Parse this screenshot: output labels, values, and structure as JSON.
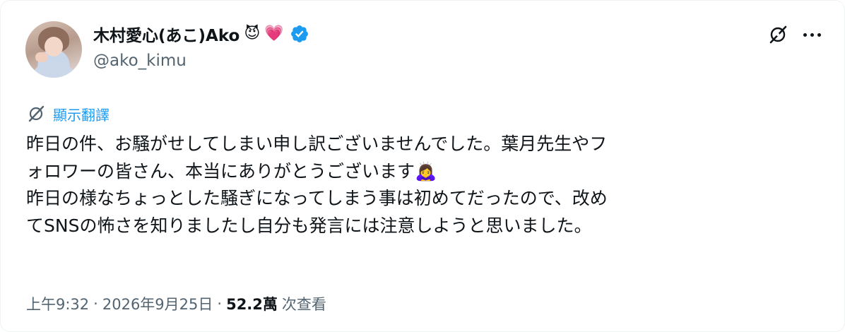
{
  "author": {
    "display_name": "木村愛心(あこ)Ako",
    "name_emojis": [
      "😈",
      "💗"
    ],
    "handle": "@ako_kimu",
    "verified": true,
    "verified_color": "#1d9bf0"
  },
  "actions": {
    "grok_icon": "grok-icon",
    "more_icon": "more-icon"
  },
  "translate": {
    "label": "顯示翻譯",
    "color": "#1d9bf0"
  },
  "tweet": {
    "lines": [
      "昨日の件、お騒がせしてしまい申し訳ございませんでした。葉月先生やフ",
      "ォロワーの皆さん、本当にありがとうございます🙇‍♀️",
      "昨日の様なちょっとした騒ぎになってしまう事は初めてだったので、改め",
      "てSNSの怖さを知りましたし自分も発言には注意しようと思いました。"
    ]
  },
  "meta": {
    "time": "上午9:32",
    "separator": "·",
    "date": "2026年9月25日",
    "views_count": "52.2萬",
    "views_label": "次查看"
  }
}
